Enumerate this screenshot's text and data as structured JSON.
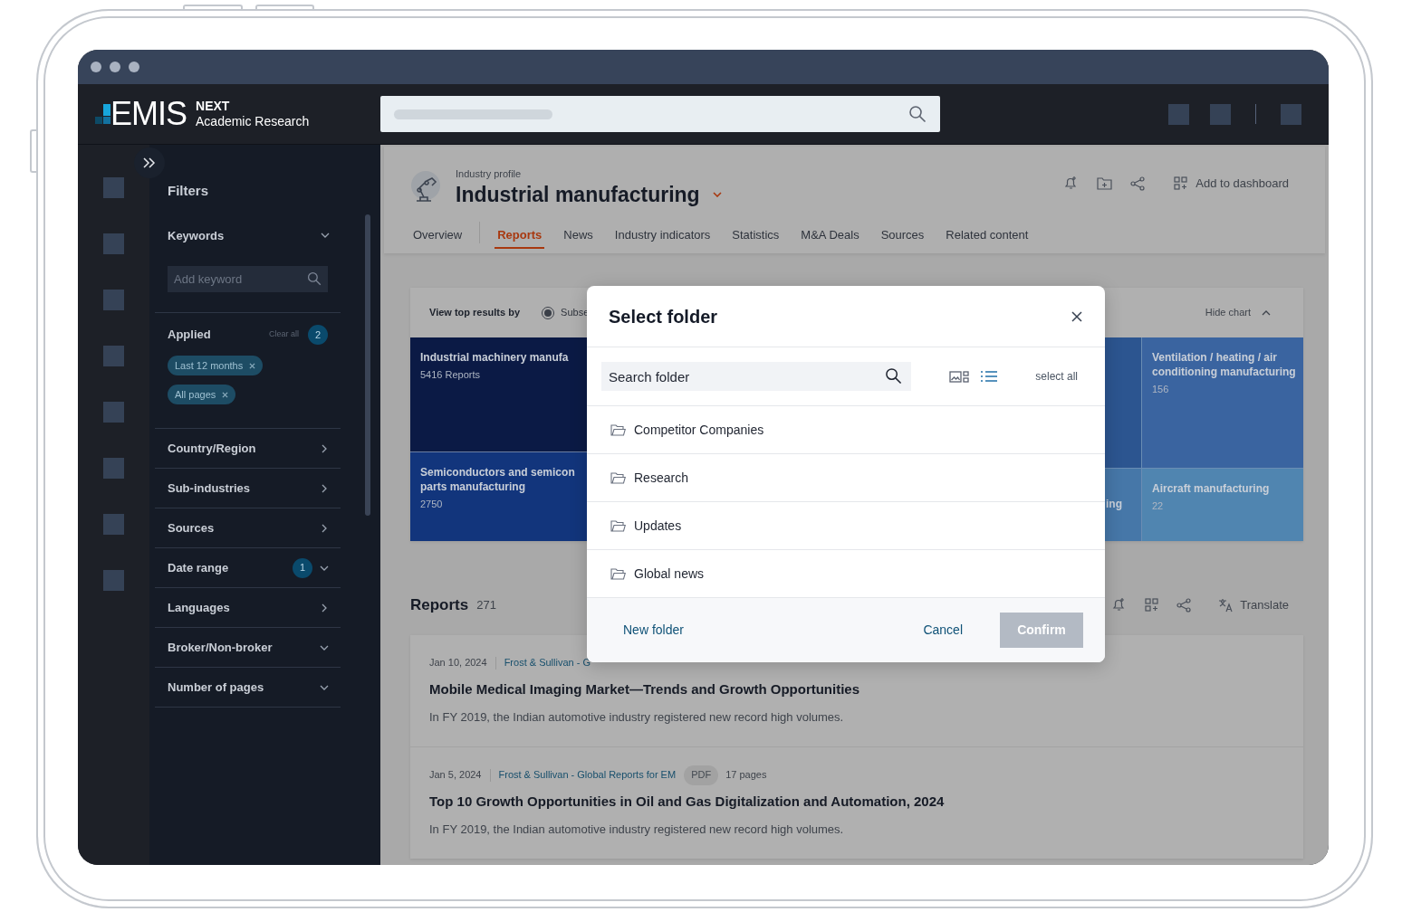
{
  "header": {
    "logo": {
      "wordmark": "EMIS",
      "tier": "NEXT",
      "product": "Academic Research"
    }
  },
  "filters": {
    "title": "Filters",
    "keywords": {
      "label": "Keywords",
      "placeholder": "Add keyword"
    },
    "applied": {
      "label": "Applied",
      "clear": "Clear all",
      "count": "2",
      "chips": [
        "Last 12 months",
        "All pages"
      ]
    },
    "sections": [
      {
        "label": "Country/Region",
        "kind": "submenu"
      },
      {
        "label": "Sub-industries",
        "kind": "submenu"
      },
      {
        "label": "Sources",
        "kind": "submenu"
      },
      {
        "label": "Date range",
        "kind": "dropdown",
        "badge": "1"
      },
      {
        "label": "Languages",
        "kind": "submenu"
      },
      {
        "label": "Broker/Non-broker",
        "kind": "dropdown"
      },
      {
        "label": "Number of pages",
        "kind": "dropdown"
      }
    ]
  },
  "page": {
    "eyebrow": "Industry profile",
    "title": "Industrial manufacturing",
    "dashboard": "Add to dashboard",
    "tabs": [
      {
        "label": "Overview",
        "selected": false
      },
      {
        "label": "Reports",
        "selected": true
      },
      {
        "label": "News",
        "selected": false
      },
      {
        "label": "Industry indicators",
        "selected": false
      },
      {
        "label": "Statistics",
        "selected": false
      },
      {
        "label": "M&A Deals",
        "selected": false
      },
      {
        "label": "Sources",
        "selected": false
      },
      {
        "label": "Related content",
        "selected": false
      }
    ]
  },
  "chart_card": {
    "label": "View top results by",
    "option": {
      "label": "Subse",
      "selected": true
    },
    "toggle": "Hide chart",
    "tiles": [
      {
        "title": "Industrial machinery manufa",
        "value": "5416 Reports",
        "color": "#0b1a45"
      },
      {
        "title": "Semiconductors and semicon parts manufacturing",
        "value": "2750",
        "color": "#12357c"
      },
      {
        "color": "#2c5590"
      },
      {
        "title": "ing",
        "color": "#4677a8"
      },
      {
        "title": "Ventilation / heating / air conditioning manufacturing",
        "value": "156",
        "color": "#3a64a0"
      },
      {
        "title": "Aircraft manufacturing",
        "value": "22",
        "color": "#5085b0"
      }
    ]
  },
  "reports": {
    "title": "Reports",
    "count": "271",
    "translate": "Translate",
    "items": [
      {
        "date": "Jan 10, 2024",
        "source": "Frost & Sullivan - G",
        "title": "Mobile Medical Imaging Market—Trends and Growth Opportunities",
        "summary": "In FY 2019, the Indian automotive industry registered new record high volumes."
      },
      {
        "date": "Jan 5, 2024",
        "source": "Frost & Sullivan - Global Reports for EM",
        "format": "PDF",
        "pages": "17 pages",
        "title": "Top 10 Growth Opportunities in Oil and Gas Digitalization and Automation, 2024",
        "summary": "In FY 2019, the Indian automotive industry registered new record high volumes."
      }
    ]
  },
  "modal": {
    "title": "Select folder",
    "search": {
      "placeholder": "Search folder"
    },
    "views": [
      {
        "kind": "grid",
        "selected": false
      },
      {
        "kind": "list",
        "selected": true
      }
    ],
    "select_all": "select all",
    "folders": [
      "Competitor Companies",
      "Research",
      "Updates",
      "Global news"
    ],
    "new_folder": "New folder",
    "cancel": "Cancel",
    "confirm": {
      "label": "Confirm",
      "disabled": true
    }
  }
}
